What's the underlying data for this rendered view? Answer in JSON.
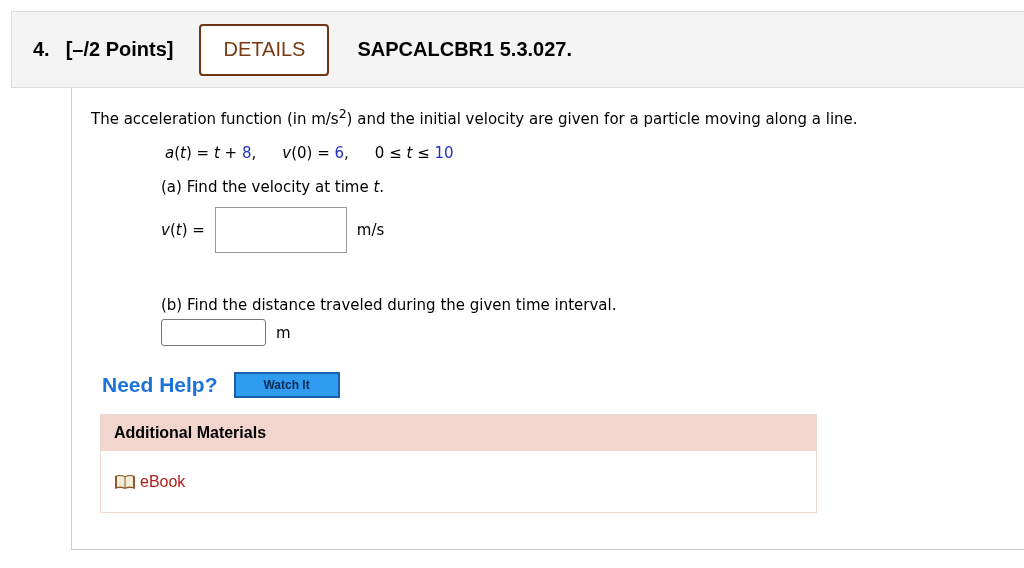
{
  "header": {
    "number": "4.",
    "points": "[–/2 Points]",
    "details_button": "DETAILS",
    "problem_id": "SAPCALCBR1 5.3.027."
  },
  "question": "The acceleration function (in m/s$^{2}$) and the initial velocity are given for a particle moving along a line.",
  "formula": [
    {
      "expression": "*a*(*t*) = *t* + ",
      "value": "8",
      "trail": ","
    },
    {
      "expression": "*v*(0) = ",
      "value": "6",
      "trail": ","
    },
    {
      "expression": "0 ≤ *t* ≤ ",
      "value": "10"
    }
  ],
  "parts": [
    {
      "kind": "labeled",
      "prompt": "(a) Find the velocity at time *t*.",
      "answer_label": "*v*(*t*) =",
      "unit": "m/s"
    },
    {
      "kind": "inline",
      "prompt": "(b) Find the distance traveled during the given time interval.",
      "unit": "m"
    }
  ],
  "help": {
    "label": "Need Help?",
    "buttons": [
      "Watch It"
    ]
  },
  "materials": {
    "title": "Additional Materials",
    "links": [
      "eBook"
    ]
  }
}
